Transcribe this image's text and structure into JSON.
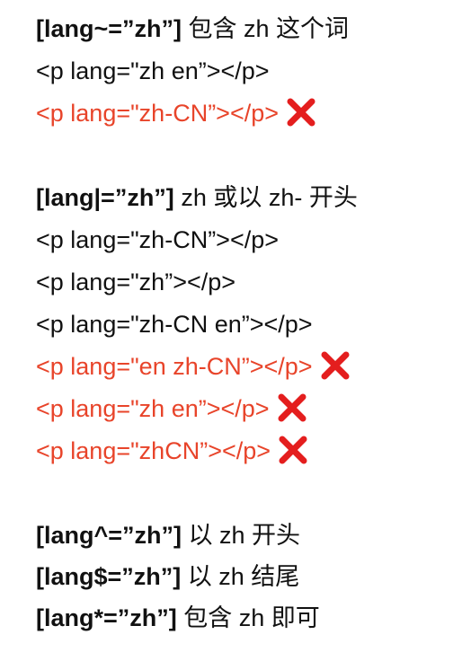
{
  "colors": {
    "text": "#111111",
    "invalid": "#e8442a",
    "cross": "#e41e1e"
  },
  "sections": [
    {
      "heading": {
        "selector": "[lang~=”zh”]",
        "desc": "包含 zh 这个词"
      },
      "examples": [
        {
          "code": "<p lang=\"zh en”></p>",
          "invalid": false
        },
        {
          "code": "<p lang=\"zh-CN”></p>",
          "invalid": true,
          "mark_icon": "cross-mark-icon"
        }
      ]
    },
    {
      "heading": {
        "selector": "[lang|=”zh”]",
        "desc": "zh 或以 zh- 开头"
      },
      "examples": [
        {
          "code": "<p lang=\"zh-CN”></p>",
          "invalid": false
        },
        {
          "code": "<p lang=\"zh”></p>",
          "invalid": false
        },
        {
          "code": "<p lang=\"zh-CN en”></p>",
          "invalid": false
        },
        {
          "code": "<p lang=\"en zh-CN”></p>",
          "invalid": true,
          "mark_icon": "cross-mark-icon"
        },
        {
          "code": "<p lang=\"zh en”></p>",
          "invalid": true,
          "mark_icon": "cross-mark-icon"
        },
        {
          "code": "<p lang=\"zhCN”></p>",
          "invalid": true,
          "mark_icon": "cross-mark-icon"
        }
      ]
    },
    {
      "rules": [
        {
          "selector": "[lang^=”zh”]",
          "desc": "以 zh 开头"
        },
        {
          "selector": "[lang$=”zh”]",
          "desc": "以 zh 结尾"
        },
        {
          "selector": "[lang*=”zh”]",
          "desc": "包含 zh 即可"
        }
      ]
    }
  ]
}
